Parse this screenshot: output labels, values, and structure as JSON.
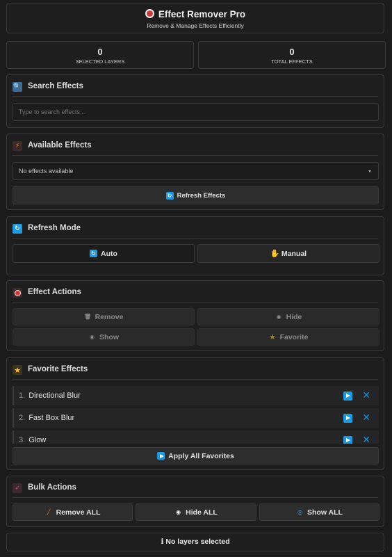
{
  "header": {
    "icon": "target-icon",
    "title": "Effect Remover Pro",
    "subtitle": "Remove & Manage Effects Efficiently"
  },
  "stats": {
    "selected_layers": {
      "value": "0",
      "label": "SELECTED LAYERS"
    },
    "total_effects": {
      "value": "0",
      "label": "TOTAL EFFECTS"
    }
  },
  "search": {
    "title": "Search Effects",
    "icon": "magnifier-icon",
    "placeholder": "Type to search effects..."
  },
  "available": {
    "title": "Available Effects",
    "icon": "lightning-icon",
    "selected": "No effects available",
    "refresh_label": "Refresh Effects"
  },
  "refresh_mode": {
    "title": "Refresh Mode",
    "icon": "refresh-icon",
    "auto_label": "Auto",
    "manual_label": "Manual"
  },
  "effect_actions": {
    "title": "Effect Actions",
    "icon": "target-icon",
    "remove_label": "Remove",
    "hide_label": "Hide",
    "show_label": "Show",
    "favorite_label": "Favorite"
  },
  "favorites": {
    "title": "Favorite Effects",
    "icon": "star-icon",
    "items": [
      {
        "num": "1.",
        "name": "Directional Blur"
      },
      {
        "num": "2.",
        "name": "Fast Box Blur"
      },
      {
        "num": "3.",
        "name": "Glow"
      }
    ],
    "apply_label": "Apply All Favorites"
  },
  "bulk": {
    "title": "Bulk Actions",
    "icon": "rocket-icon",
    "remove_all_label": "Remove ALL",
    "hide_all_label": "Hide ALL",
    "show_all_label": "Show ALL"
  },
  "status": {
    "icon": "info-icon",
    "text": "No layers selected"
  },
  "colors": {
    "background": "#1b1b1b",
    "panel": "#1e1e1e",
    "accent_blue": "#1b9be0"
  }
}
